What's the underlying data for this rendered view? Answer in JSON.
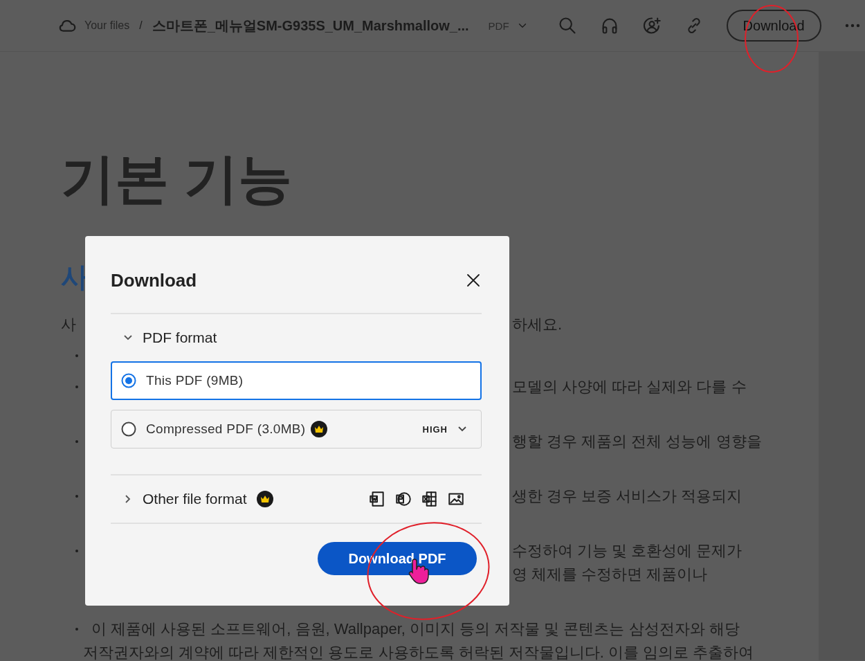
{
  "topbar": {
    "root": "Your files",
    "separator": "/",
    "file_name": "스마트폰_메뉴얼SM-G935S_UM_Marshmallow_...",
    "file_type": "PDF",
    "download_button": "Download"
  },
  "document": {
    "heading": "기본 기능",
    "subheading": "사",
    "rows": [
      {
        "kind": "paragraph",
        "left": "사",
        "right": "하세요."
      },
      {
        "kind": "bullet"
      },
      {
        "kind": "bullet",
        "right": "모델의 사양에 따라 실제와 다를 수"
      },
      {
        "kind": "blank"
      },
      {
        "kind": "bullet",
        "right": "행할 경우 제품의 전체 성능에 영향을"
      },
      {
        "kind": "blank"
      },
      {
        "kind": "bullet",
        "right": "생한 경우 보증 서비스가 적용되지"
      },
      {
        "kind": "blank"
      },
      {
        "kind": "bullet",
        "right": "수정하여 기능 및 호환성에 문제가"
      },
      {
        "kind": "continuation",
        "right": "영 체제를 수정하면 제품이나"
      },
      {
        "kind": "blank"
      },
      {
        "kind": "bullet",
        "full": "이 제품에 사용된 소프트웨어, 음원, Wallpaper, 이미지 등의 저작물 및 콘텐츠는 삼성전자와 해당"
      },
      {
        "kind": "continuation",
        "full": "저작권자와의 계약에 따라 제한적인 용도로 사용하도록 허락된 저작물입니다. 이를 임의로 추출하여"
      }
    ]
  },
  "dialog": {
    "title": "Download",
    "sections": [
      {
        "title": "PDF format",
        "expanded": true,
        "options": [
          {
            "label": "This PDF (9MB)",
            "selected": true
          },
          {
            "label": "Compressed PDF (3.0MB)",
            "selected": false,
            "premium": true,
            "quality": "HIGH"
          }
        ]
      },
      {
        "title": "Other file format",
        "expanded": false,
        "premium": true
      }
    ],
    "primary_button": "Download PDF"
  }
}
